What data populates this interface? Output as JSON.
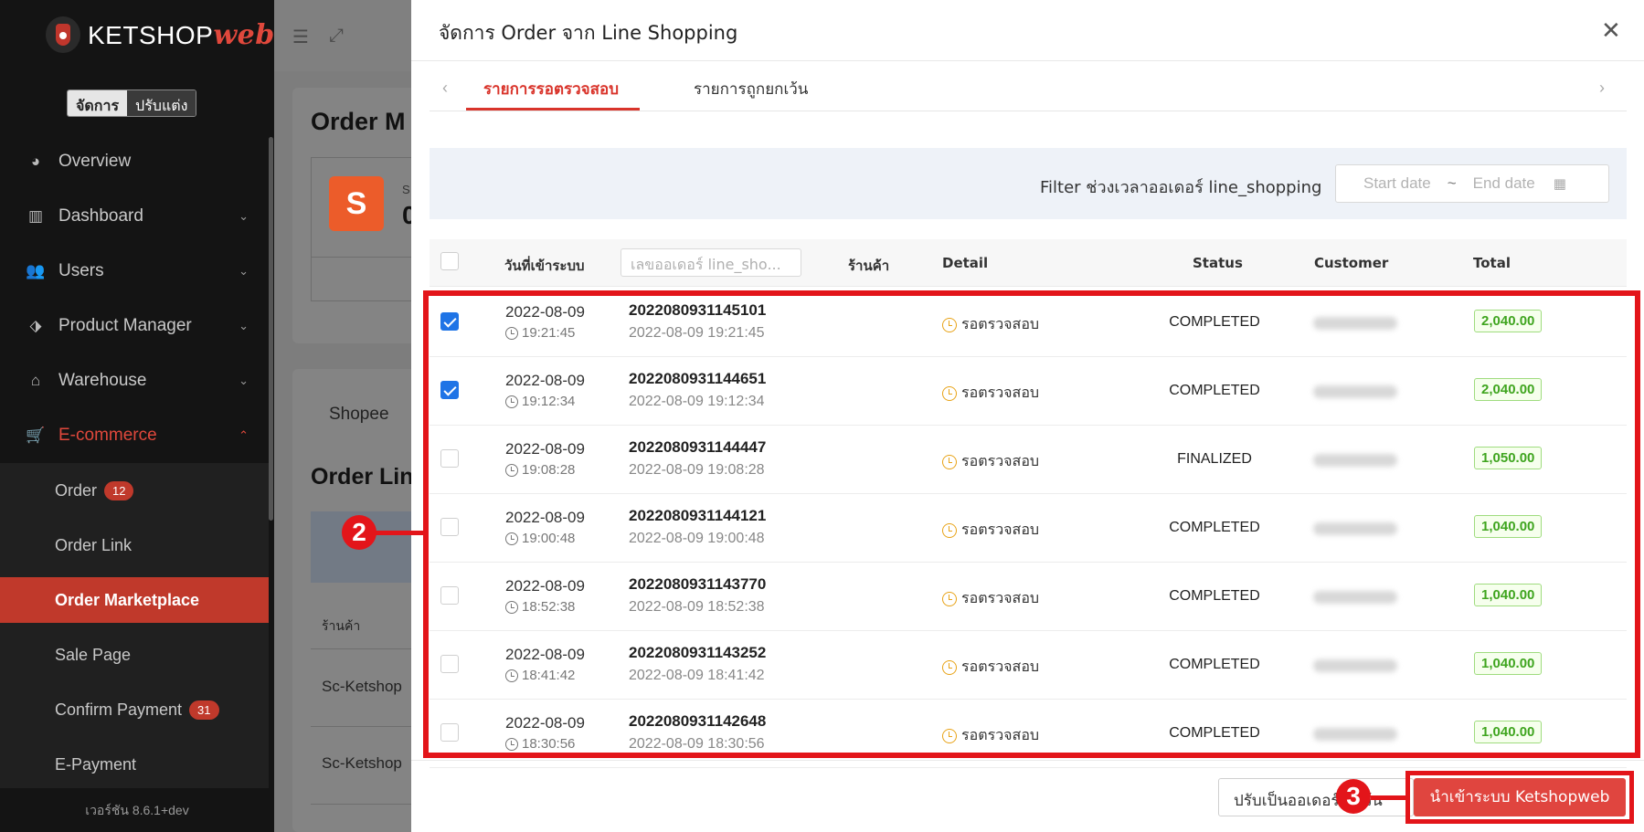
{
  "sidebar": {
    "logo_main": "KETSHOP",
    "logo_accent": "web",
    "mode_active": "จัดการ",
    "mode_inactive": "ปรับแต่ง",
    "items": [
      {
        "label": "Overview",
        "icon": "pie-chart-icon"
      },
      {
        "label": "Dashboard",
        "icon": "bar-chart-icon"
      },
      {
        "label": "Users",
        "icon": "users-icon"
      },
      {
        "label": "Product Manager",
        "icon": "tags-icon"
      },
      {
        "label": "Warehouse",
        "icon": "warehouse-icon"
      },
      {
        "label": "E-commerce",
        "icon": "cart-icon"
      }
    ],
    "subitems": [
      {
        "label": "Order",
        "badge": "12"
      },
      {
        "label": "Order Link"
      },
      {
        "label": "Order Marketplace"
      },
      {
        "label": "Sale Page"
      },
      {
        "label": "Confirm Payment",
        "badge": "31"
      },
      {
        "label": "E-Payment"
      }
    ],
    "version": "เวอร์ชัน 8.6.1+dev"
  },
  "background": {
    "title": "Order M",
    "shopee_letter": "S",
    "shopee_peek_1": "S",
    "shopee_peek_2": "0",
    "tab_shopee": "Shopee",
    "title2": "Order Lin",
    "col_shop": "ร้านค้า",
    "row1": "Sc-Ketshop",
    "row2": "Sc-Ketshop"
  },
  "modal": {
    "title": "จัดการ Order จาก Line Shopping",
    "tabs": [
      "รายการรอตรวจสอบ",
      "รายการถูกยกเว้น"
    ],
    "filter_label": "Filter ช่วงเวลาออเดอร์ line_shopping",
    "start_placeholder": "Start date",
    "tilde": "~",
    "end_placeholder": "End date",
    "columns": {
      "date": "วันที่เข้าระบบ",
      "order_search_placeholder": "เลขออเดอร์ line_sho...",
      "shop": "ร้านค้า",
      "detail": "Detail",
      "status": "Status",
      "customer": "Customer",
      "total": "Total"
    },
    "rows": [
      {
        "checked": true,
        "date": "2022-08-09",
        "time": "19:21:45",
        "order_no": "2022080931145101",
        "created": "2022-08-09 19:21:45",
        "detail": "รอตรวจสอบ",
        "status": "COMPLETED",
        "total": "2,040.00"
      },
      {
        "checked": true,
        "date": "2022-08-09",
        "time": "19:12:34",
        "order_no": "2022080931144651",
        "created": "2022-08-09 19:12:34",
        "detail": "รอตรวจสอบ",
        "status": "COMPLETED",
        "total": "2,040.00"
      },
      {
        "checked": false,
        "date": "2022-08-09",
        "time": "19:08:28",
        "order_no": "2022080931144447",
        "created": "2022-08-09 19:08:28",
        "detail": "รอตรวจสอบ",
        "status": "FINALIZED",
        "total": "1,050.00"
      },
      {
        "checked": false,
        "date": "2022-08-09",
        "time": "19:00:48",
        "order_no": "2022080931144121",
        "created": "2022-08-09 19:00:48",
        "detail": "รอตรวจสอบ",
        "status": "COMPLETED",
        "total": "1,040.00"
      },
      {
        "checked": false,
        "date": "2022-08-09",
        "time": "18:52:38",
        "order_no": "2022080931143770",
        "created": "2022-08-09 18:52:38",
        "detail": "รอตรวจสอบ",
        "status": "COMPLETED",
        "total": "1,040.00"
      },
      {
        "checked": false,
        "date": "2022-08-09",
        "time": "18:41:42",
        "order_no": "2022080931143252",
        "created": "2022-08-09 18:41:42",
        "detail": "รอตรวจสอบ",
        "status": "COMPLETED",
        "total": "1,040.00"
      },
      {
        "checked": false,
        "date": "2022-08-09",
        "time": "18:30:56",
        "order_no": "2022080931142648",
        "created": "2022-08-09 18:30:56",
        "detail": "รอตรวจสอบ",
        "status": "COMPLETED",
        "total": "1,040.00"
      }
    ],
    "btn_secondary": "ปรับเป็นออเดอร์ยกเว้น",
    "btn_primary": "นำเข้าระบบ Ketshopweb",
    "annotations": [
      "2",
      "3"
    ]
  },
  "colors": {
    "accent_red": "#d9342b",
    "annotation_red": "#e3151a",
    "checkbox_blue": "#1f74e6",
    "total_green": "#3fa51f",
    "pending_orange": "#e8a317"
  }
}
